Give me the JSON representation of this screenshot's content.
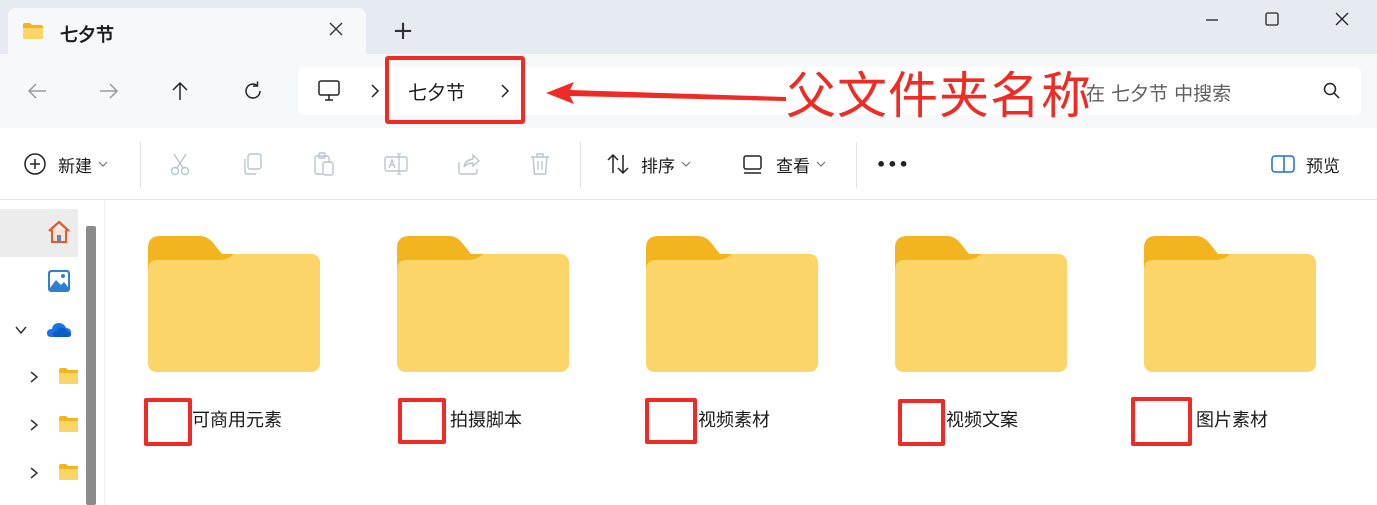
{
  "window": {
    "tab_title": "七夕节",
    "tab_close_icon": "close-icon",
    "new_tab_glyph": "+",
    "controls": [
      "minimize-icon",
      "maximize-icon",
      "close-icon"
    ]
  },
  "navigation": {
    "buttons": [
      "back-arrow-icon",
      "forward-arrow-icon",
      "up-arrow-icon",
      "refresh-icon"
    ]
  },
  "address": {
    "root_icon": "computer-icon",
    "current_folder": "七夕节",
    "separator_icon": "chevron-right-icon"
  },
  "search": {
    "placeholder": "在 七夕节 中搜索",
    "icon": "search-icon"
  },
  "toolbar": {
    "new_label": "新建",
    "sort_label": "排序",
    "view_label": "查看",
    "more_label": "•••",
    "preview_label": "预览",
    "icons": [
      "cut-icon",
      "copy-icon",
      "paste-icon",
      "rename-icon",
      "share-icon",
      "delete-icon"
    ]
  },
  "sidebar": {
    "items": [
      "home-icon",
      "gallery-icon",
      "onedrive-icon",
      "folder-icon",
      "folder-icon",
      "folder-icon"
    ]
  },
  "folders": [
    {
      "name": "可商用元素"
    },
    {
      "name": "拍摄脚本"
    },
    {
      "name": "视频素材"
    },
    {
      "name": "视频文案"
    },
    {
      "name": "图片素材"
    }
  ],
  "annotation": {
    "text": "父文件夹名称",
    "color": "#ee2b24"
  },
  "colors": {
    "folder_back": "#f2b51f",
    "folder_front": "#fcd569",
    "annotation_red": "#ee2b24"
  }
}
